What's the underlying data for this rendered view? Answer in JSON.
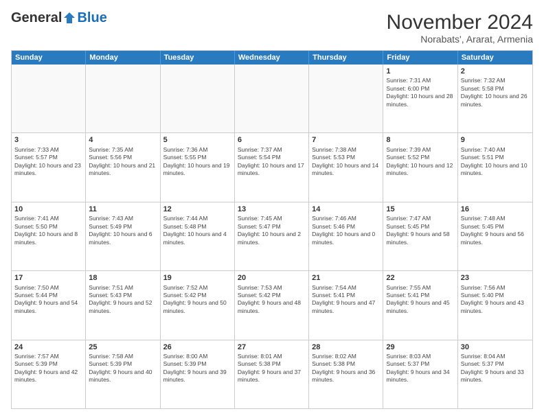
{
  "logo": {
    "general": "General",
    "blue": "Blue"
  },
  "title": "November 2024",
  "location": "Norabats', Ararat, Armenia",
  "weekdays": [
    "Sunday",
    "Monday",
    "Tuesday",
    "Wednesday",
    "Thursday",
    "Friday",
    "Saturday"
  ],
  "rows": [
    [
      {
        "day": "",
        "sunrise": "",
        "sunset": "",
        "daylight": "",
        "empty": true
      },
      {
        "day": "",
        "sunrise": "",
        "sunset": "",
        "daylight": "",
        "empty": true
      },
      {
        "day": "",
        "sunrise": "",
        "sunset": "",
        "daylight": "",
        "empty": true
      },
      {
        "day": "",
        "sunrise": "",
        "sunset": "",
        "daylight": "",
        "empty": true
      },
      {
        "day": "",
        "sunrise": "",
        "sunset": "",
        "daylight": "",
        "empty": true
      },
      {
        "day": "1",
        "sunrise": "Sunrise: 7:31 AM",
        "sunset": "Sunset: 6:00 PM",
        "daylight": "Daylight: 10 hours and 28 minutes.",
        "empty": false
      },
      {
        "day": "2",
        "sunrise": "Sunrise: 7:32 AM",
        "sunset": "Sunset: 5:58 PM",
        "daylight": "Daylight: 10 hours and 26 minutes.",
        "empty": false
      }
    ],
    [
      {
        "day": "3",
        "sunrise": "Sunrise: 7:33 AM",
        "sunset": "Sunset: 5:57 PM",
        "daylight": "Daylight: 10 hours and 23 minutes.",
        "empty": false
      },
      {
        "day": "4",
        "sunrise": "Sunrise: 7:35 AM",
        "sunset": "Sunset: 5:56 PM",
        "daylight": "Daylight: 10 hours and 21 minutes.",
        "empty": false
      },
      {
        "day": "5",
        "sunrise": "Sunrise: 7:36 AM",
        "sunset": "Sunset: 5:55 PM",
        "daylight": "Daylight: 10 hours and 19 minutes.",
        "empty": false
      },
      {
        "day": "6",
        "sunrise": "Sunrise: 7:37 AM",
        "sunset": "Sunset: 5:54 PM",
        "daylight": "Daylight: 10 hours and 17 minutes.",
        "empty": false
      },
      {
        "day": "7",
        "sunrise": "Sunrise: 7:38 AM",
        "sunset": "Sunset: 5:53 PM",
        "daylight": "Daylight: 10 hours and 14 minutes.",
        "empty": false
      },
      {
        "day": "8",
        "sunrise": "Sunrise: 7:39 AM",
        "sunset": "Sunset: 5:52 PM",
        "daylight": "Daylight: 10 hours and 12 minutes.",
        "empty": false
      },
      {
        "day": "9",
        "sunrise": "Sunrise: 7:40 AM",
        "sunset": "Sunset: 5:51 PM",
        "daylight": "Daylight: 10 hours and 10 minutes.",
        "empty": false
      }
    ],
    [
      {
        "day": "10",
        "sunrise": "Sunrise: 7:41 AM",
        "sunset": "Sunset: 5:50 PM",
        "daylight": "Daylight: 10 hours and 8 minutes.",
        "empty": false
      },
      {
        "day": "11",
        "sunrise": "Sunrise: 7:43 AM",
        "sunset": "Sunset: 5:49 PM",
        "daylight": "Daylight: 10 hours and 6 minutes.",
        "empty": false
      },
      {
        "day": "12",
        "sunrise": "Sunrise: 7:44 AM",
        "sunset": "Sunset: 5:48 PM",
        "daylight": "Daylight: 10 hours and 4 minutes.",
        "empty": false
      },
      {
        "day": "13",
        "sunrise": "Sunrise: 7:45 AM",
        "sunset": "Sunset: 5:47 PM",
        "daylight": "Daylight: 10 hours and 2 minutes.",
        "empty": false
      },
      {
        "day": "14",
        "sunrise": "Sunrise: 7:46 AM",
        "sunset": "Sunset: 5:46 PM",
        "daylight": "Daylight: 10 hours and 0 minutes.",
        "empty": false
      },
      {
        "day": "15",
        "sunrise": "Sunrise: 7:47 AM",
        "sunset": "Sunset: 5:45 PM",
        "daylight": "Daylight: 9 hours and 58 minutes.",
        "empty": false
      },
      {
        "day": "16",
        "sunrise": "Sunrise: 7:48 AM",
        "sunset": "Sunset: 5:45 PM",
        "daylight": "Daylight: 9 hours and 56 minutes.",
        "empty": false
      }
    ],
    [
      {
        "day": "17",
        "sunrise": "Sunrise: 7:50 AM",
        "sunset": "Sunset: 5:44 PM",
        "daylight": "Daylight: 9 hours and 54 minutes.",
        "empty": false
      },
      {
        "day": "18",
        "sunrise": "Sunrise: 7:51 AM",
        "sunset": "Sunset: 5:43 PM",
        "daylight": "Daylight: 9 hours and 52 minutes.",
        "empty": false
      },
      {
        "day": "19",
        "sunrise": "Sunrise: 7:52 AM",
        "sunset": "Sunset: 5:42 PM",
        "daylight": "Daylight: 9 hours and 50 minutes.",
        "empty": false
      },
      {
        "day": "20",
        "sunrise": "Sunrise: 7:53 AM",
        "sunset": "Sunset: 5:42 PM",
        "daylight": "Daylight: 9 hours and 48 minutes.",
        "empty": false
      },
      {
        "day": "21",
        "sunrise": "Sunrise: 7:54 AM",
        "sunset": "Sunset: 5:41 PM",
        "daylight": "Daylight: 9 hours and 47 minutes.",
        "empty": false
      },
      {
        "day": "22",
        "sunrise": "Sunrise: 7:55 AM",
        "sunset": "Sunset: 5:41 PM",
        "daylight": "Daylight: 9 hours and 45 minutes.",
        "empty": false
      },
      {
        "day": "23",
        "sunrise": "Sunrise: 7:56 AM",
        "sunset": "Sunset: 5:40 PM",
        "daylight": "Daylight: 9 hours and 43 minutes.",
        "empty": false
      }
    ],
    [
      {
        "day": "24",
        "sunrise": "Sunrise: 7:57 AM",
        "sunset": "Sunset: 5:39 PM",
        "daylight": "Daylight: 9 hours and 42 minutes.",
        "empty": false
      },
      {
        "day": "25",
        "sunrise": "Sunrise: 7:58 AM",
        "sunset": "Sunset: 5:39 PM",
        "daylight": "Daylight: 9 hours and 40 minutes.",
        "empty": false
      },
      {
        "day": "26",
        "sunrise": "Sunrise: 8:00 AM",
        "sunset": "Sunset: 5:39 PM",
        "daylight": "Daylight: 9 hours and 39 minutes.",
        "empty": false
      },
      {
        "day": "27",
        "sunrise": "Sunrise: 8:01 AM",
        "sunset": "Sunset: 5:38 PM",
        "daylight": "Daylight: 9 hours and 37 minutes.",
        "empty": false
      },
      {
        "day": "28",
        "sunrise": "Sunrise: 8:02 AM",
        "sunset": "Sunset: 5:38 PM",
        "daylight": "Daylight: 9 hours and 36 minutes.",
        "empty": false
      },
      {
        "day": "29",
        "sunrise": "Sunrise: 8:03 AM",
        "sunset": "Sunset: 5:37 PM",
        "daylight": "Daylight: 9 hours and 34 minutes.",
        "empty": false
      },
      {
        "day": "30",
        "sunrise": "Sunrise: 8:04 AM",
        "sunset": "Sunset: 5:37 PM",
        "daylight": "Daylight: 9 hours and 33 minutes.",
        "empty": false
      }
    ]
  ]
}
